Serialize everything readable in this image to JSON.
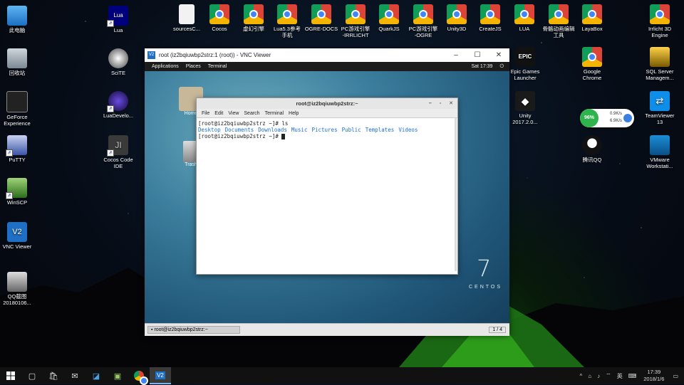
{
  "desktop_icons_left": [
    {
      "id": "this-pc",
      "label": "此电脑"
    },
    {
      "id": "recycle-bin",
      "label": "回收站"
    },
    {
      "id": "geforce",
      "label": "GeForce\nExperience"
    },
    {
      "id": "putty",
      "label": "PuTTY"
    },
    {
      "id": "winscp",
      "label": "WinSCP"
    },
    {
      "id": "vnc-viewer",
      "label": "VNC Viewer"
    },
    {
      "id": "qq-screenshot",
      "label": "QQ截图\n20180106..."
    }
  ],
  "desktop_icons_col2": [
    {
      "id": "lua",
      "label": "Lua"
    },
    {
      "id": "scite",
      "label": "SciTE"
    },
    {
      "id": "luadevelo",
      "label": "LuaDevelo..."
    },
    {
      "id": "cocos-ide",
      "label": "Cocos Code\nIDE"
    }
  ],
  "desktop_icons_top": [
    {
      "id": "sourcesc",
      "label": "sourcesC..."
    },
    {
      "id": "cocos",
      "label": "Cocos"
    },
    {
      "id": "xuhuan",
      "label": "虚幻引擎"
    },
    {
      "id": "lua53",
      "label": "Lua5.3参考\n手机"
    },
    {
      "id": "ogre-docs",
      "label": "OGRE-DOCS"
    },
    {
      "id": "pc-irrlicht",
      "label": "PC游戏引擎\n-IRRLICHT"
    },
    {
      "id": "quarkjs",
      "label": "QuarkJS"
    },
    {
      "id": "pc-ogre",
      "label": "PC游戏引擎\n-OGRE"
    },
    {
      "id": "unity3d",
      "label": "Unity3D"
    },
    {
      "id": "createjs",
      "label": "CreateJS"
    },
    {
      "id": "lua-link",
      "label": "LUA"
    },
    {
      "id": "skeleton",
      "label": "骨骼动画编辑\n工具"
    },
    {
      "id": "layabox",
      "label": "LayaBox"
    }
  ],
  "desktop_icons_right": [
    {
      "id": "epic",
      "label": "Epic Games\nLauncher"
    },
    {
      "id": "unity2017",
      "label": "Unity\n2017.2.0..."
    },
    {
      "id": "google-chrome",
      "label": "Google\nChrome"
    },
    {
      "id": "tencent-qq",
      "label": "腾讯QQ"
    },
    {
      "id": "irrlicht3d",
      "label": "Irrlicht 3D\nEngine"
    },
    {
      "id": "sql-server",
      "label": "SQL Server\nManagem..."
    },
    {
      "id": "teamviewer",
      "label": "TeamViewer\n13"
    },
    {
      "id": "vmware",
      "label": "VMware\nWorkstati..."
    }
  ],
  "net_widget": {
    "percent": "96%",
    "up": "0.9K/s",
    "down": "6.9K/s"
  },
  "vnc": {
    "title": "root (iz2bqiuwbp2strz:1 (root)) - VNC Viewer",
    "gnome_menu": [
      "Applications",
      "Places",
      "Terminal"
    ],
    "gnome_clock": "Sat 17:39",
    "desktop_icons": [
      "Home",
      "Trash"
    ],
    "centos_num": "7",
    "centos_text": "CENTOS",
    "taskbar_item": "root@iz2bqiuwbp2strz:~",
    "workspace": "1 / 4"
  },
  "terminal": {
    "title": "root@iz2bqiuwbp2strz:~",
    "menu": [
      "File",
      "Edit",
      "View",
      "Search",
      "Terminal",
      "Help"
    ],
    "line1": "[root@iz2bqiuwbp2strz ~]# ls",
    "ls_items": [
      "Desktop",
      "Documents",
      "Downloads",
      "Music",
      "Pictures",
      "Public",
      "Templates",
      "Videos"
    ],
    "line3": "[root@iz2bqiuwbp2strz ~]# "
  },
  "taskbar": {
    "clock_time": "17:39",
    "clock_date": "2018/1/6",
    "ime": "英"
  }
}
